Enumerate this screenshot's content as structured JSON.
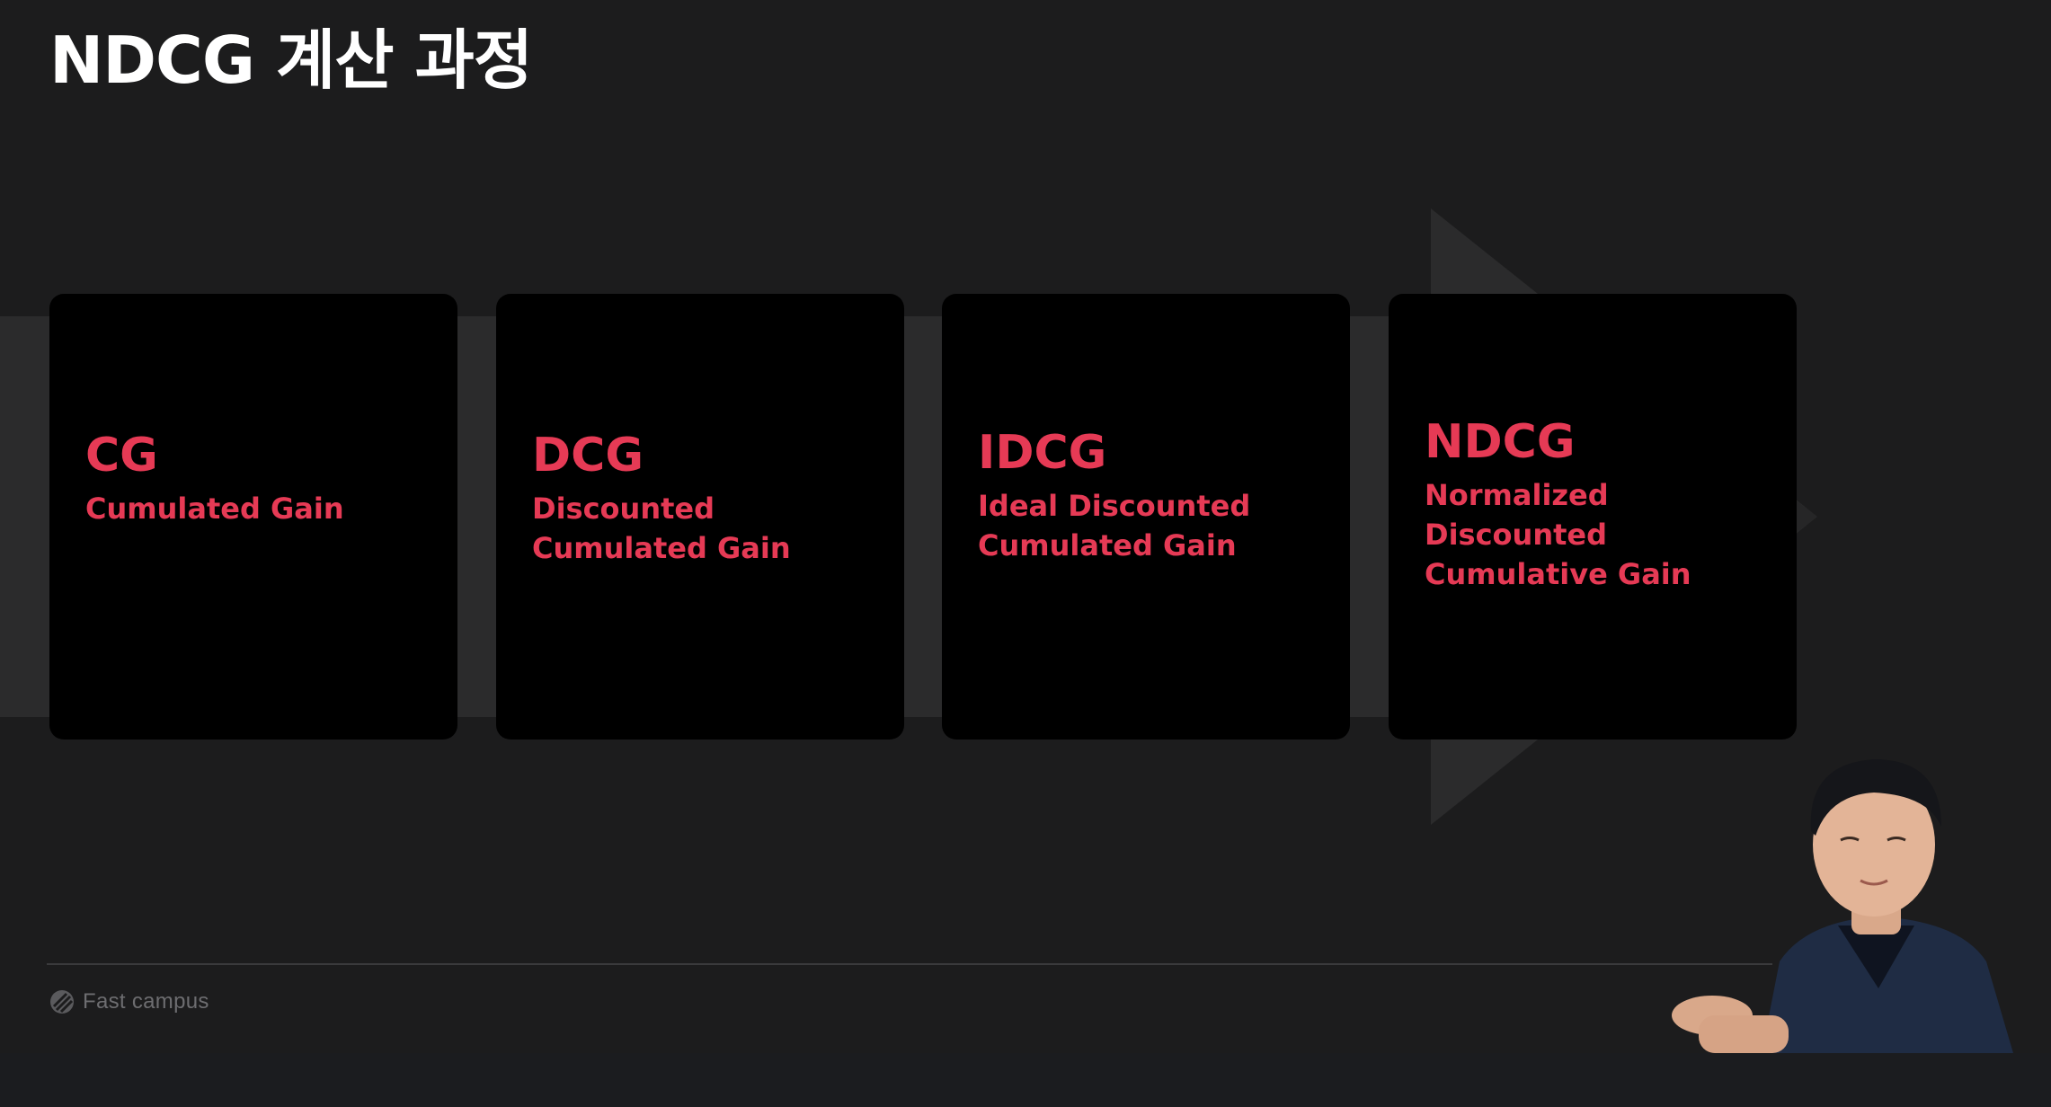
{
  "slide": {
    "title": "NDCG 계산 과정"
  },
  "cards": [
    {
      "abbr": "CG",
      "full": "Cumulated Gain"
    },
    {
      "abbr": "DCG",
      "full": "Discounted Cumulated Gain"
    },
    {
      "abbr": "IDCG",
      "full": "Ideal Discounted Cumulated Gain"
    },
    {
      "abbr": "NDCG",
      "full": "Normalized Discounted Cumulative Gain"
    }
  ],
  "footer": {
    "brand": "Fast campus",
    "brand_icon": "fastcampus-logo-icon"
  },
  "colors": {
    "accent": "#e63a55",
    "background": "#1c1c1d",
    "card": "#000000",
    "title": "#ffffff"
  }
}
